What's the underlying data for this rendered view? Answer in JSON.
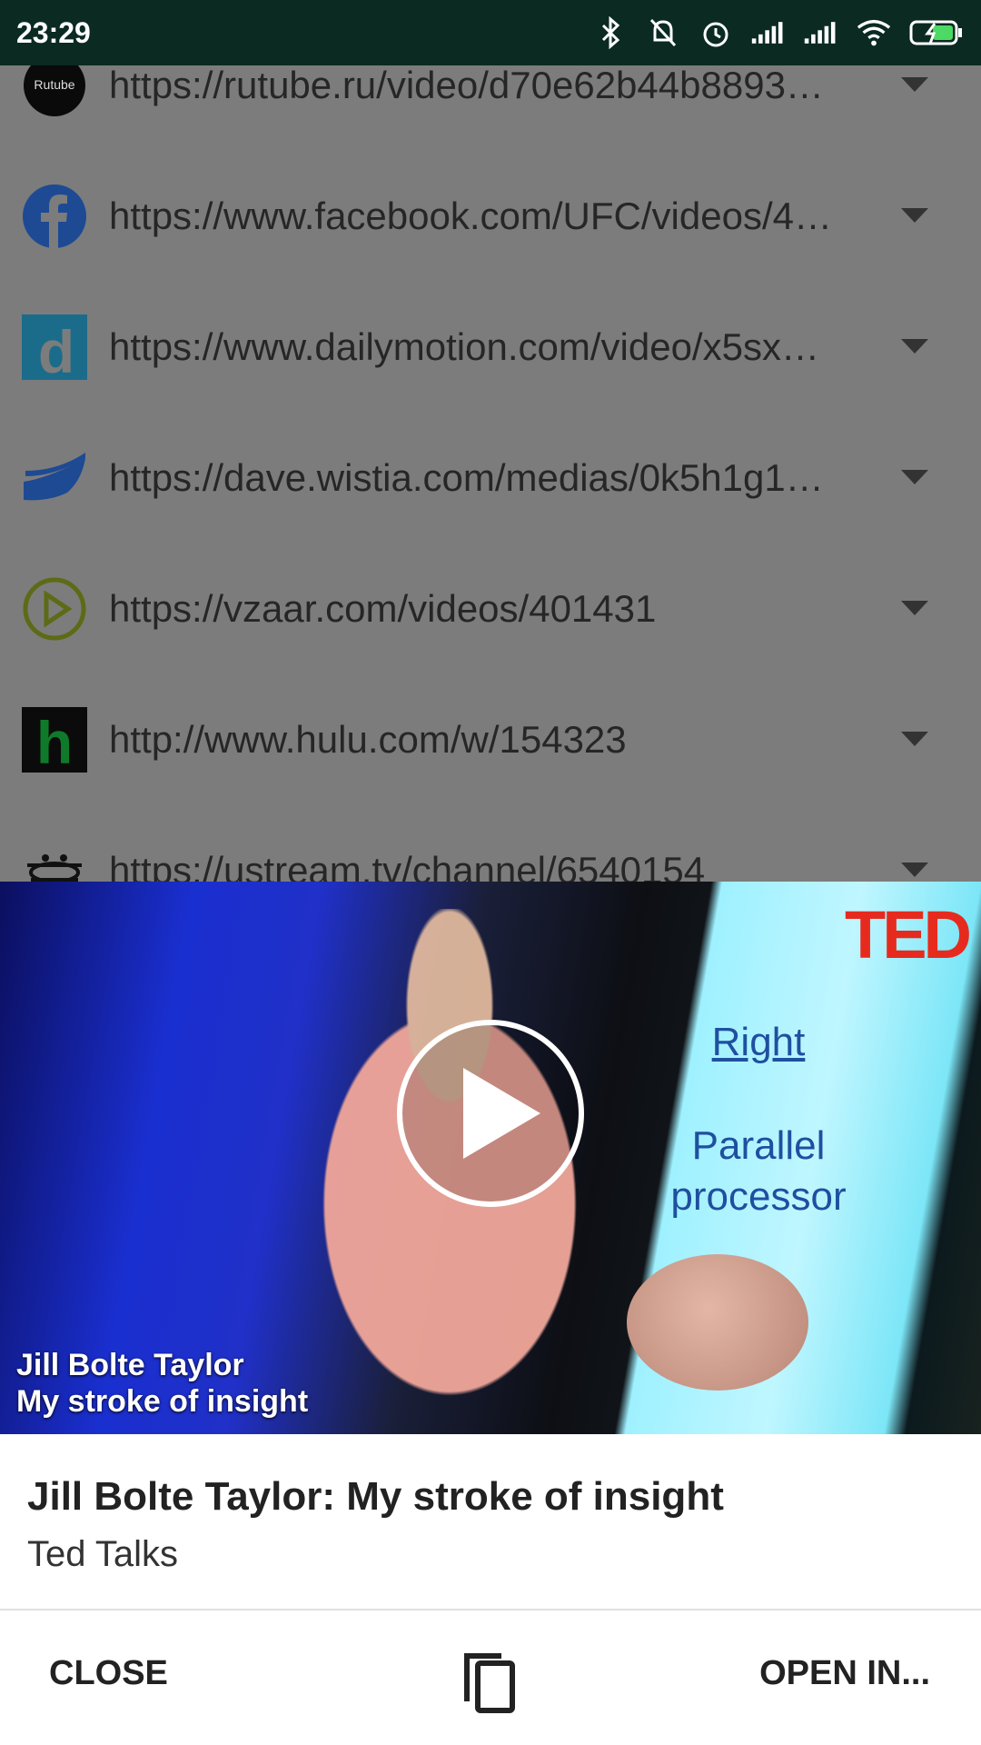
{
  "status_bar": {
    "time": "23:29",
    "icons": [
      "bluetooth-icon",
      "notifications-off-icon",
      "alarm-icon",
      "signal-icon",
      "signal-icon",
      "wifi-icon",
      "battery-charging-icon"
    ]
  },
  "list": {
    "items": [
      {
        "logo": "Rutube",
        "url": "https://rutube.ru/video/d70e62b44b8893…"
      },
      {
        "logo": "facebook",
        "url": "https://www.facebook.com/UFC/videos/4…"
      },
      {
        "logo": "d",
        "url": "https://www.dailymotion.com/video/x5sx…"
      },
      {
        "logo": "wistia",
        "url": "https://dave.wistia.com/medias/0k5h1g1…"
      },
      {
        "logo": "vzaar",
        "url": "https://vzaar.com/videos/401431"
      },
      {
        "logo": "h",
        "url": "http://www.hulu.com/w/154323"
      },
      {
        "logo": "ustream",
        "url": "https://ustream.tv/channel/6540154"
      }
    ]
  },
  "video": {
    "brand": "TED",
    "slide_line1": "Right",
    "slide_line2": "Parallel",
    "slide_line3": "processor",
    "caption_line1": "Jill Bolte Taylor",
    "caption_line2": "My stroke of insight"
  },
  "info": {
    "title": "Jill Bolte Taylor: My stroke of insight",
    "channel": "Ted Talks"
  },
  "actions": {
    "close_label": "CLOSE",
    "open_label": "OPEN IN..."
  },
  "colors": {
    "status_bar": "#0a2a22",
    "ted_red": "#e62b1e"
  }
}
